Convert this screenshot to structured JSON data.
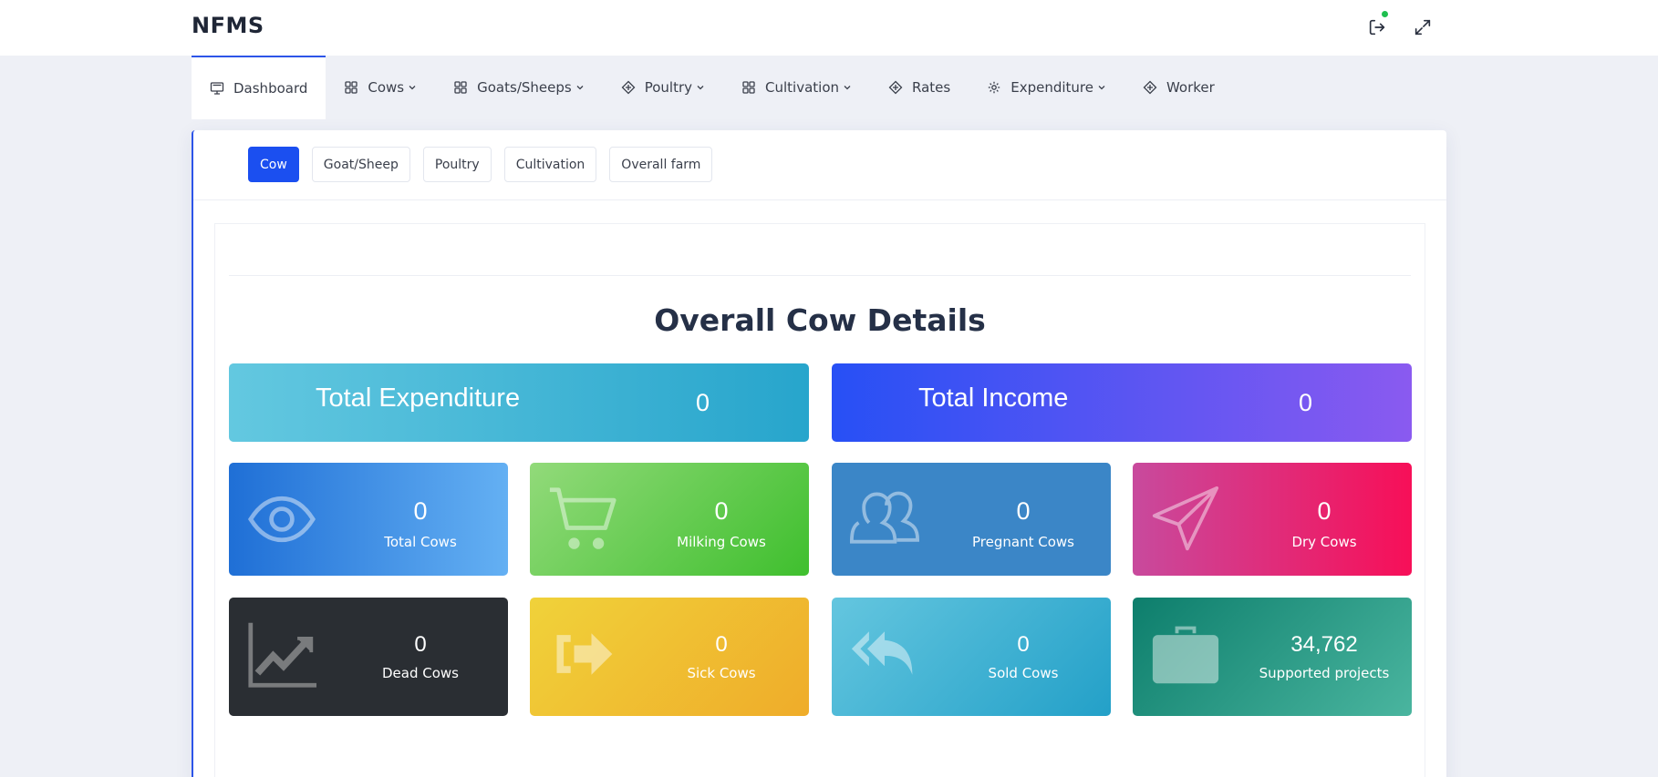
{
  "header": {
    "brand": "NFMS"
  },
  "nav": {
    "items": [
      {
        "label": "Dashboard"
      },
      {
        "label": "Cows"
      },
      {
        "label": "Goats/Sheeps"
      },
      {
        "label": "Poultry"
      },
      {
        "label": "Cultivation"
      },
      {
        "label": "Rates"
      },
      {
        "label": "Expenditure"
      },
      {
        "label": "Worker"
      }
    ]
  },
  "tabs": [
    {
      "label": "Cow"
    },
    {
      "label": "Goat/Sheep"
    },
    {
      "label": "Poultry"
    },
    {
      "label": "Cultivation"
    },
    {
      "label": "Overall farm"
    }
  ],
  "main": {
    "title": "Overall Cow Details",
    "total_expenditure": {
      "label": "Total Expenditure",
      "value": "0"
    },
    "total_income": {
      "label": "Total Income",
      "value": "0"
    },
    "stats": [
      {
        "label": "Total Cows",
        "value": "0"
      },
      {
        "label": "Milking Cows",
        "value": "0"
      },
      {
        "label": "Pregnant Cows",
        "value": "0"
      },
      {
        "label": "Dry Cows",
        "value": "0"
      },
      {
        "label": "Dead Cows",
        "value": "0"
      },
      {
        "label": "Sick Cows",
        "value": "0"
      },
      {
        "label": "Sold Cows",
        "value": "0"
      },
      {
        "label": "Supported projects",
        "value": "34,762"
      }
    ]
  },
  "colors": {
    "accent": "#1b4ff0",
    "notification": "#1fbf4f"
  }
}
